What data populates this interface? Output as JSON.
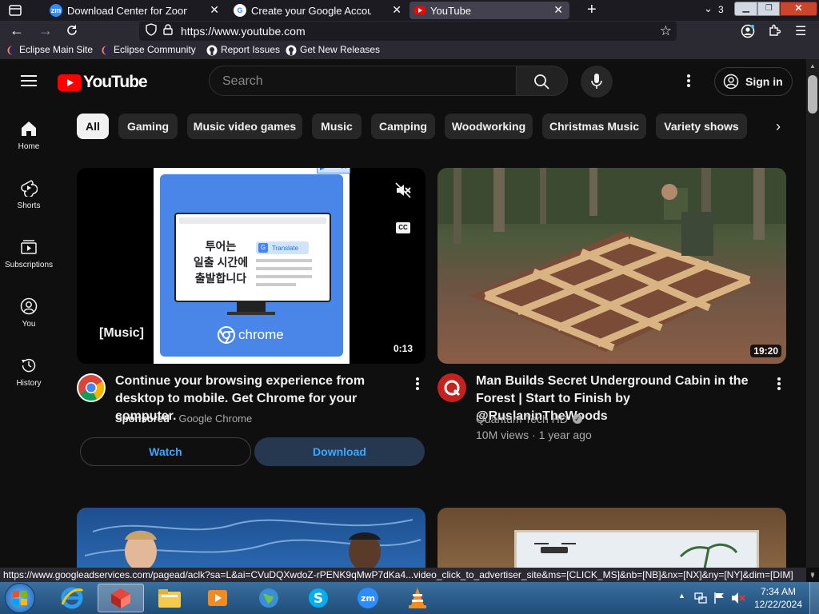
{
  "browser": {
    "tabs": [
      {
        "title": "Download Center for Zoom",
        "favicon": "zm"
      },
      {
        "title": "Create your Google Account",
        "favicon": "G"
      },
      {
        "title": "YouTube",
        "favicon": "yt"
      }
    ],
    "tab_count": "3",
    "url": "https://www.youtube.com",
    "bookmarks": [
      "Eclipse Main Site",
      "Eclipse Community",
      "Report Issues",
      "Get New Releases"
    ],
    "status_url": "https://www.googleadservices.com/pagead/aclk?sa=L&ai=CVuDQXwdoZ-rPENK9qMwP7dKa4...video_click_to_advertiser_site&ms=[CLICK_MS]&nb=[NB]&nx=[NX]&ny=[NY]&dim=[DIM]"
  },
  "youtube": {
    "logo_text": "YouTube",
    "search_placeholder": "Search",
    "sign_in": "Sign in",
    "chips": [
      "All",
      "Gaming",
      "Music video games",
      "Music",
      "Camping",
      "Woodworking",
      "Christmas Music",
      "Variety shows"
    ],
    "nav": [
      "Home",
      "Shorts",
      "Subscriptions",
      "You",
      "History"
    ]
  },
  "ad": {
    "caption": "[Music]",
    "duration": "0:13",
    "korean_text": [
      "투어는",
      "일출 시간에",
      "출발합니다"
    ],
    "translate_label": "Translate",
    "chrome_label": "chrome",
    "title": "Continue your browsing experience from desktop to mobile. Get Chrome for your computer.",
    "sponsored": "Sponsored",
    "advertiser": "Google Chrome",
    "watch": "Watch",
    "download": "Download"
  },
  "video": {
    "duration": "19:20",
    "title": "Man Builds Secret Underground Cabin in the Forest | Start to Finish by @RuslaninTheWoods",
    "channel": "Quantum Tech HD",
    "views": "10M views",
    "age": "1 year ago"
  },
  "taskbar": {
    "time": "7:34 AM",
    "date": "12/22/2024"
  },
  "colors": {
    "yt_red": "#ff0000",
    "bg": "#0f0f0f",
    "chip": "#272727",
    "link_blue": "#3ea6ff",
    "firefox_dark": "#1c1b22"
  }
}
